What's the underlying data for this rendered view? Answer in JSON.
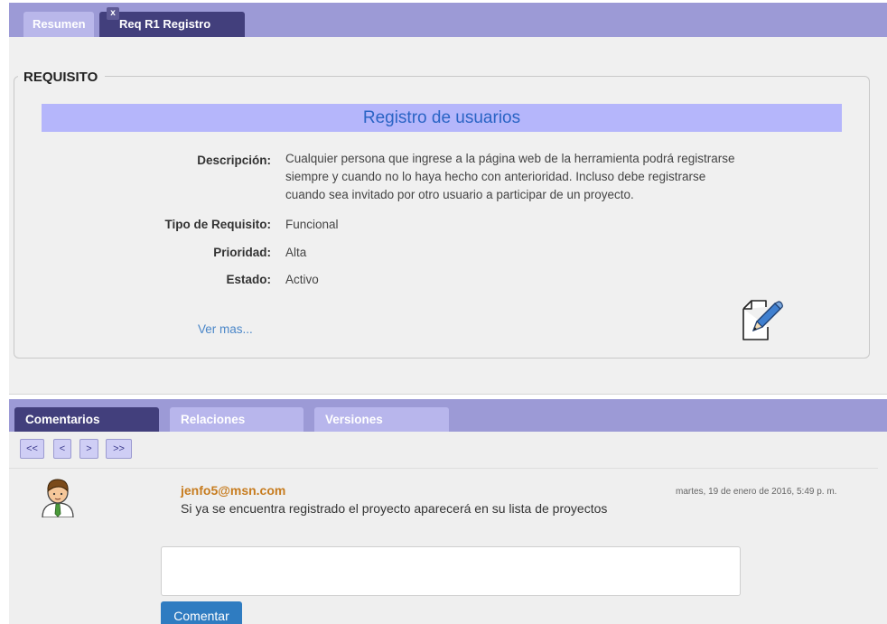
{
  "top_tabs": {
    "resumen": "Resumen",
    "close": "x",
    "req": "Req R1 Registro"
  },
  "requisito": {
    "legend": "REQUISITO",
    "title": "Registro de usuarios",
    "fields": [
      {
        "label": "Descripción:",
        "value": "Cualquier persona que ingrese a la página web de la herramienta podrá registrarse siempre y cuando no lo haya hecho con anterioridad. Incluso debe registrarse cuando sea invitado por otro usuario a participar de un proyecto."
      },
      {
        "label": "Tipo de Requisito:",
        "value": "Funcional"
      },
      {
        "label": "Prioridad:",
        "value": "Alta"
      },
      {
        "label": "Estado:",
        "value": "Activo"
      }
    ],
    "ver_mas": "Ver mas...",
    "edit_icon": "edit-document-icon"
  },
  "bottom_tabs": {
    "comentarios": "Comentarios",
    "relaciones": "Relaciones",
    "versiones": "Versiones"
  },
  "pager": {
    "first": "<<",
    "prev": "<",
    "next": ">",
    "last": ">>"
  },
  "comment": {
    "author": "jenfo5@msn.com",
    "date": "martes, 19 de enero de 2016, 5:49 p. m.",
    "text": "Si ya se encuentra registrado el proyecto aparecerá en su lista de proyectos",
    "avatar_icon": "user-avatar-icon"
  },
  "comment_form": {
    "input_value": "",
    "button": "Comentar"
  },
  "colors": {
    "tabbar": "#9c9ad6",
    "active_tab": "#423f7c",
    "title_bar": "#b5b6fb",
    "title_text": "#2a64c5",
    "author": "#c77c1f",
    "button": "#2f7cc1"
  }
}
